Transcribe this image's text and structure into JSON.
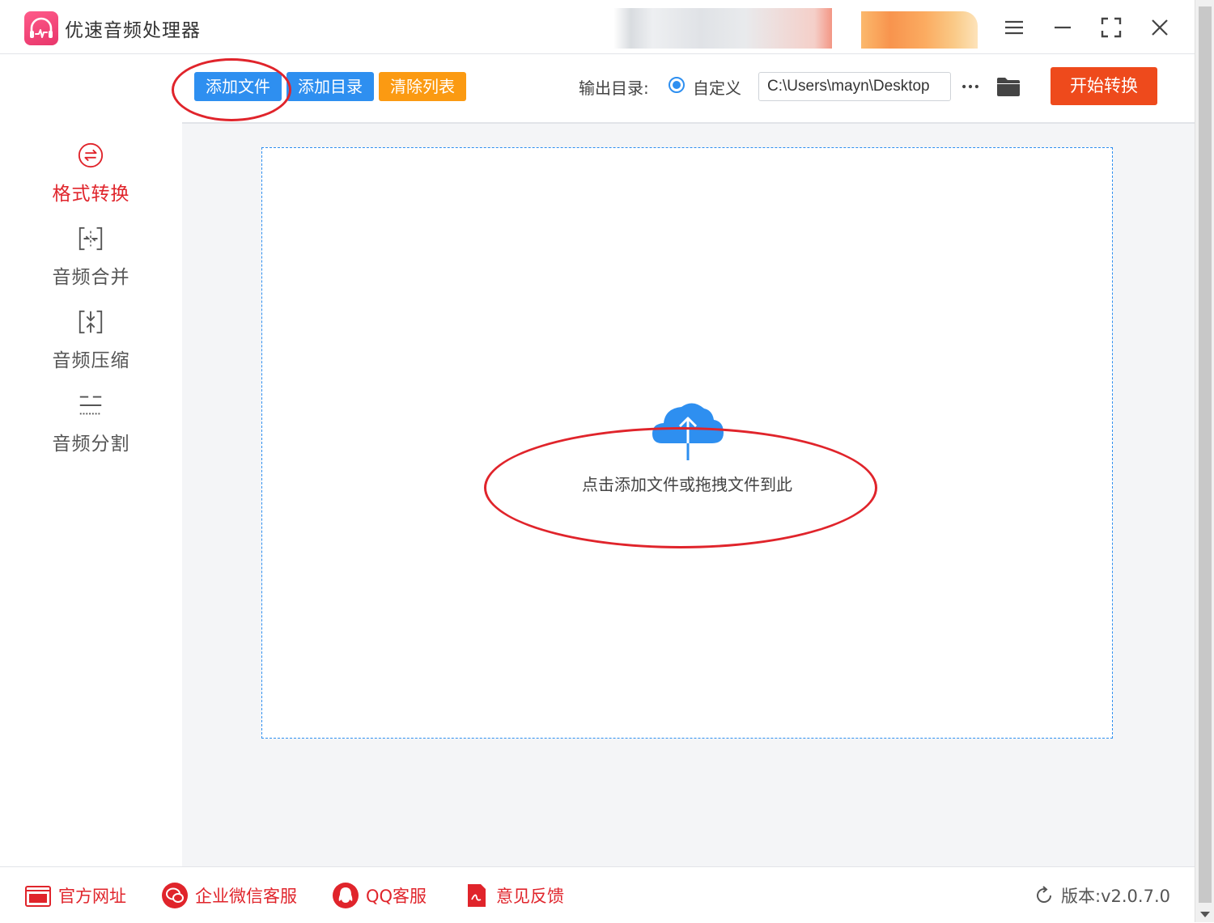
{
  "app": {
    "title": "优速音频处理器"
  },
  "sidebar": {
    "items": [
      {
        "label": "格式转换",
        "icon": "format-convert-icon",
        "active": true
      },
      {
        "label": "音频合并",
        "icon": "audio-merge-icon",
        "active": false
      },
      {
        "label": "音频压缩",
        "icon": "audio-compress-icon",
        "active": false
      },
      {
        "label": "音频分割",
        "icon": "audio-split-icon",
        "active": false
      }
    ]
  },
  "toolbar": {
    "add_file": "添加文件",
    "add_folder": "添加目录",
    "clear_list": "清除列表",
    "output_label": "输出目录:",
    "custom_option": "自定义",
    "output_path": "C:\\Users\\mayn\\Desktop",
    "more": "···",
    "start": "开始转换"
  },
  "dropzone": {
    "hint": "点击添加文件或拖拽文件到此"
  },
  "footer": {
    "links": [
      {
        "label": "官方网址",
        "icon": "website-icon"
      },
      {
        "label": "企业微信客服",
        "icon": "wechat-icon"
      },
      {
        "label": "QQ客服",
        "icon": "qq-icon"
      },
      {
        "label": "意见反馈",
        "icon": "feedback-icon"
      }
    ],
    "version": "版本:v2.0.7.0"
  },
  "colors": {
    "accent_blue": "#2e8ff0",
    "accent_orange": "#fb9a12",
    "start_red": "#ee4a1c",
    "active_red": "#e0242b",
    "logo_pink": "#e8366b"
  }
}
